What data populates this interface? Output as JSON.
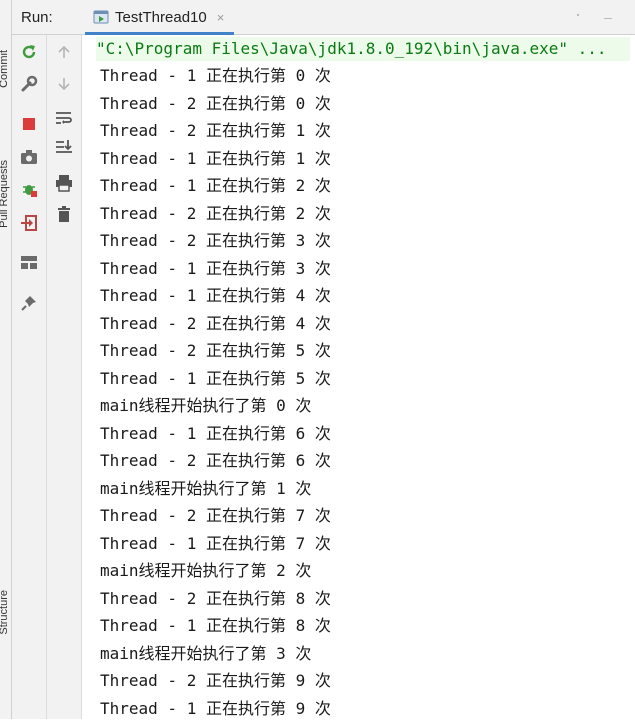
{
  "topbar": {
    "run_label": "Run:",
    "tab_title": "TestThread10",
    "tab_close": "×"
  },
  "left_strip": {
    "labels": [
      "Commit",
      "Pull Requests",
      "Structure"
    ]
  },
  "toolbar_left": [
    {
      "name": "rerun-icon",
      "color": "#3f9b3f"
    },
    {
      "name": "settings-wrench-icon",
      "color": "#6b6b6b"
    },
    {
      "name": "stop-icon",
      "color": "#db3b3b"
    },
    {
      "name": "camera-icon",
      "color": "#6b6b6b"
    },
    {
      "name": "bug-icon",
      "color": "#3f9b3f"
    },
    {
      "name": "login-icon",
      "color": "#b84646"
    },
    {
      "name": "layout-icon",
      "color": "#6b6b6b"
    },
    {
      "name": "pin-icon",
      "color": "#6b6b6b"
    }
  ],
  "toolbar_right": [
    {
      "name": "up-arrow-icon"
    },
    {
      "name": "down-arrow-icon"
    },
    {
      "name": "soft-wrap-icon"
    },
    {
      "name": "scroll-to-end-icon"
    },
    {
      "name": "print-icon"
    },
    {
      "name": "trash-icon"
    }
  ],
  "console": {
    "command": "\"C:\\Program Files\\Java\\jdk1.8.0_192\\bin\\java.exe\" ...",
    "lines": [
      "Thread - 1 正在执行第 0 次",
      "Thread - 2 正在执行第 0 次",
      "Thread - 2 正在执行第 1 次",
      "Thread - 1 正在执行第 1 次",
      "Thread - 1 正在执行第 2 次",
      "Thread - 2 正在执行第 2 次",
      "Thread - 2 正在执行第 3 次",
      "Thread - 1 正在执行第 3 次",
      "Thread - 1 正在执行第 4 次",
      "Thread - 2 正在执行第 4 次",
      "Thread - 2 正在执行第 5 次",
      "Thread - 1 正在执行第 5 次",
      "main线程开始执行了第 0 次",
      "Thread - 1 正在执行第 6 次",
      "Thread - 2 正在执行第 6 次",
      "main线程开始执行了第 1 次",
      "Thread - 2 正在执行第 7 次",
      "Thread - 1 正在执行第 7 次",
      "main线程开始执行了第 2 次",
      "Thread - 2 正在执行第 8 次",
      "Thread - 1 正在执行第 8 次",
      "main线程开始执行了第 3 次",
      "Thread - 2 正在执行第 9 次",
      "Thread - 1 正在执行第 9 次"
    ]
  }
}
